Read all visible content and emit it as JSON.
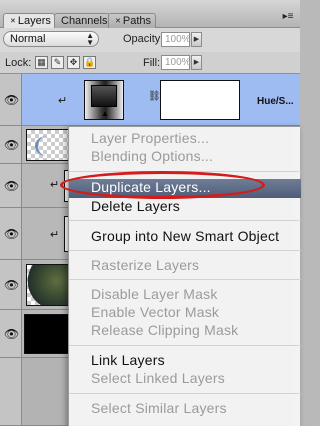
{
  "tabs": [
    {
      "label": "Layers",
      "active": true
    },
    {
      "label": "Channels",
      "active": false
    },
    {
      "label": "Paths",
      "active": false
    }
  ],
  "blend": {
    "mode": "Normal",
    "opacity_label": "Opacity:",
    "opacity_value": "100%"
  },
  "lock": {
    "label": "Lock:",
    "fill_label": "Fill:",
    "fill_value": "100%"
  },
  "layers": [
    {
      "name": "Hue/S..."
    }
  ],
  "context_menu": {
    "items": [
      {
        "label": "Layer Properties...",
        "enabled": false
      },
      {
        "label": "Blending Options...",
        "enabled": false
      },
      {
        "label": "Duplicate Layers...",
        "enabled": true,
        "highlighted": true
      },
      {
        "label": "Delete Layers",
        "enabled": true
      },
      {
        "label": "Group into New Smart Object",
        "enabled": true
      },
      {
        "label": "Rasterize Layers",
        "enabled": false
      },
      {
        "label": "Disable Layer Mask",
        "enabled": false
      },
      {
        "label": "Enable Vector Mask",
        "enabled": false
      },
      {
        "label": "Release Clipping Mask",
        "enabled": false
      },
      {
        "label": "Link Layers",
        "enabled": true
      },
      {
        "label": "Select Linked Layers",
        "enabled": false
      },
      {
        "label": "Select Similar Layers",
        "enabled": false
      }
    ]
  },
  "colors": {
    "selection": "#9fbcf2",
    "highlight": "#5a6884",
    "annotation_oval": "#d41c1c"
  }
}
